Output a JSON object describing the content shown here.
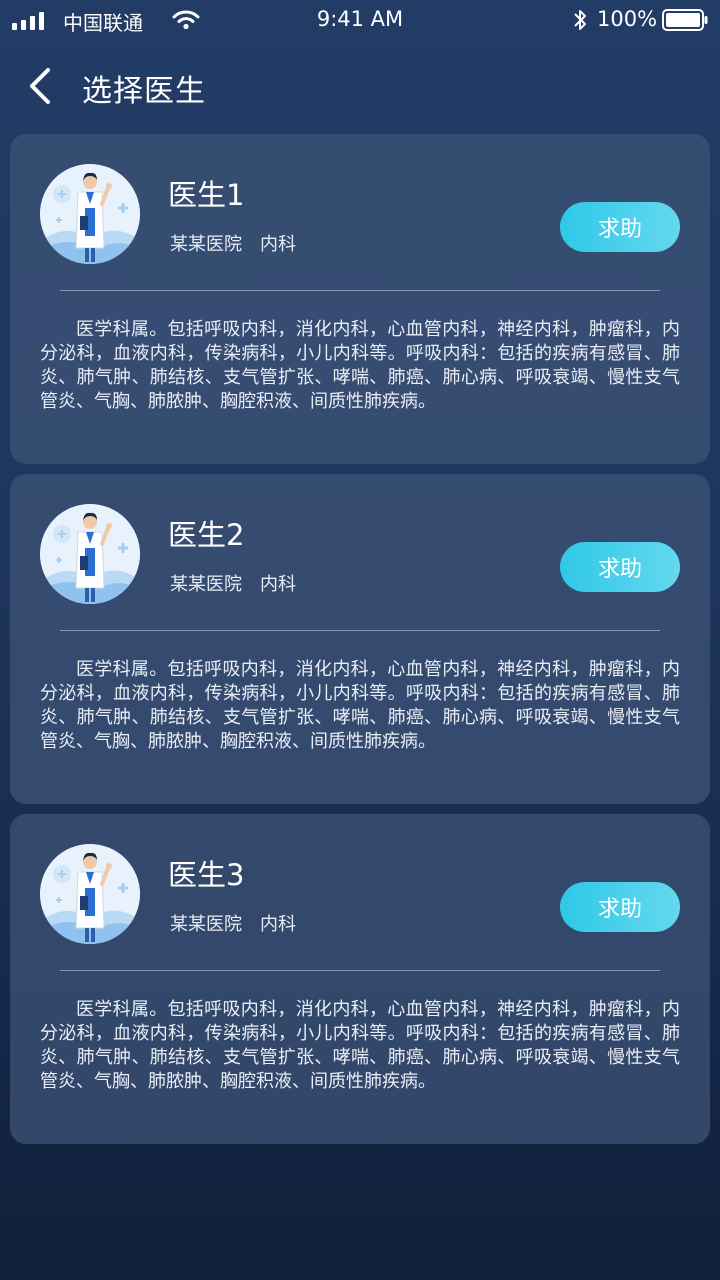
{
  "status_bar": {
    "carrier": "中国联通",
    "time": "9:41 AM",
    "battery": "100%",
    "icons": [
      "signal-icon",
      "wifi-icon",
      "bluetooth-icon",
      "battery-icon"
    ]
  },
  "nav": {
    "title": "选择医生",
    "back_icon": "chevron-left-icon"
  },
  "colors": {
    "accent": "#3dcce8",
    "card_bg": "#3e5478"
  },
  "doctors": [
    {
      "name": "医生1",
      "hospital": "某某医院",
      "department": "内科",
      "help_label": "求助",
      "description": "医学科属。包括呼吸内科，消化内科，心血管内科，神经内科，肿瘤科，内分泌科，血液内科，传染病科，小儿内科等。呼吸内科：包括的疾病有感冒、肺炎、肺气肿、肺结核、支气管扩张、哮喘、肺癌、肺心病、呼吸衰竭、慢性支气管炎、气胸、肺脓肿、胸腔积液、间质性肺疾病。"
    },
    {
      "name": "医生2",
      "hospital": "某某医院",
      "department": "内科",
      "help_label": "求助",
      "description": "医学科属。包括呼吸内科，消化内科，心血管内科，神经内科，肿瘤科，内分泌科，血液内科，传染病科，小儿内科等。呼吸内科：包括的疾病有感冒、肺炎、肺气肿、肺结核、支气管扩张、哮喘、肺癌、肺心病、呼吸衰竭、慢性支气管炎、气胸、肺脓肿、胸腔积液、间质性肺疾病。"
    },
    {
      "name": "医生3",
      "hospital": "某某医院",
      "department": "内科",
      "help_label": "求助",
      "description": "医学科属。包括呼吸内科，消化内科，心血管内科，神经内科，肿瘤科，内分泌科，血液内科，传染病科，小儿内科等。呼吸内科：包括的疾病有感冒、肺炎、肺气肿、肺结核、支气管扩张、哮喘、肺癌、肺心病、呼吸衰竭、慢性支气管炎、气胸、肺脓肿、胸腔积液、间质性肺疾病。"
    }
  ]
}
